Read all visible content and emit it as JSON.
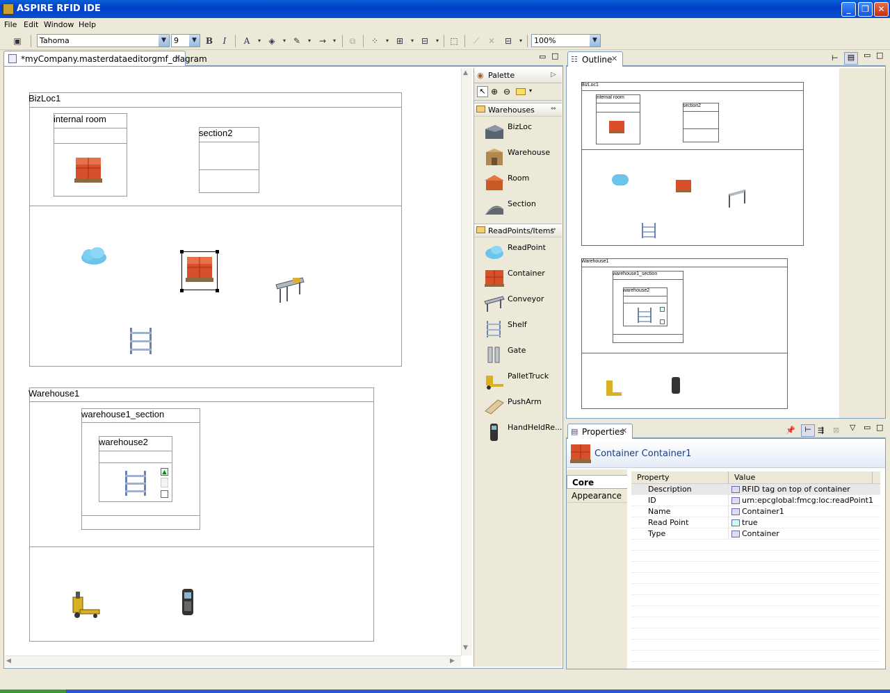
{
  "app": {
    "title": "ASPIRE RFID IDE"
  },
  "menu": [
    "File",
    "Edit",
    "Window",
    "Help"
  ],
  "toolbar": {
    "font": "Tahoma",
    "size": "9",
    "zoom": "100%",
    "bold": "B",
    "italic": "I"
  },
  "editor": {
    "tab_label": "*myCompany.masterdataeditorgmf_diagram",
    "diagram": {
      "bizloc1": "BizLoc1",
      "internal_room": "internal room",
      "section2": "section2",
      "warehouse1": "Warehouse1",
      "warehouse1_section": "warehouse1_section",
      "warehouse2": "warehouse2"
    }
  },
  "palette": {
    "title": "Palette",
    "drawers": [
      {
        "label": "Warehouses",
        "items": [
          "BizLoc",
          "Warehouse",
          "Room",
          "Section"
        ]
      },
      {
        "label": "ReadPoints/Items",
        "items": [
          "ReadPoint",
          "Container",
          "Conveyor",
          "Shelf",
          "Gate",
          "PalletTruck",
          "PushArm",
          "HandHeldRe..."
        ]
      }
    ]
  },
  "outline": {
    "tab_label": "Outline",
    "labels": {
      "bizloc1": "BizLoc1",
      "internal_room": "internal room",
      "section2": "section2",
      "warehouse1": "Warehouse1",
      "warehouse1_section": "warehouse1_section",
      "warehouse2": "warehouse2"
    }
  },
  "properties": {
    "tab_label": "Properties",
    "banner": "Container Container1",
    "tabs": [
      "Core",
      "Appearance"
    ],
    "columns": [
      "Property",
      "Value"
    ],
    "rows": [
      {
        "property": "Description",
        "value": "RFID tag on top of container"
      },
      {
        "property": "ID",
        "value": "urn:epcglobal:fmcg:loc:readPoint1"
      },
      {
        "property": "Name",
        "value": "Container1"
      },
      {
        "property": "Read Point",
        "value": "true"
      },
      {
        "property": "Type",
        "value": "Container"
      }
    ]
  }
}
